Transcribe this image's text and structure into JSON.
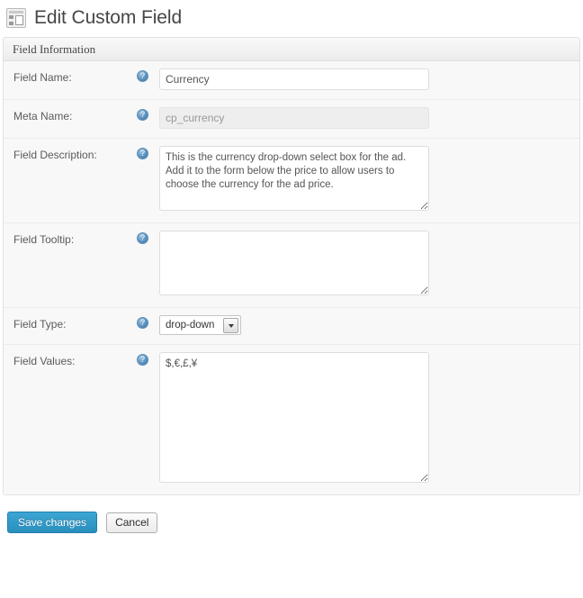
{
  "header": {
    "icon": "screen-layout-icon",
    "title": "Edit Custom Field"
  },
  "panel": {
    "title": "Field Information",
    "help_icon": "help-question-icon",
    "rows": [
      {
        "label": "Field Name:",
        "control": "text",
        "value": "Currency",
        "placeholder": "",
        "disabled": false
      },
      {
        "label": "Meta Name:",
        "control": "text",
        "value": "cp_currency",
        "placeholder": "cp_currency",
        "disabled": true
      },
      {
        "label": "Field Description:",
        "control": "textarea",
        "value": "This is the currency drop-down select box for the ad. Add it to the form below the price to allow users to choose the currency for the ad price.",
        "placeholder": ""
      },
      {
        "label": "Field Tooltip:",
        "control": "textarea",
        "value": "",
        "placeholder": ""
      },
      {
        "label": "Field Type:",
        "control": "select",
        "value": "drop-down",
        "options": [
          "drop-down"
        ]
      },
      {
        "label": "Field Values:",
        "control": "textarea",
        "value": "$,€,£,¥",
        "placeholder": ""
      }
    ]
  },
  "footer": {
    "save_label": "Save changes",
    "cancel_label": "Cancel"
  },
  "colors": {
    "accent": "#2a8ebb",
    "panel_bg": "#f8f8f8",
    "border": "#e1e1e1",
    "text": "#5a5a5a",
    "title": "#464646"
  }
}
